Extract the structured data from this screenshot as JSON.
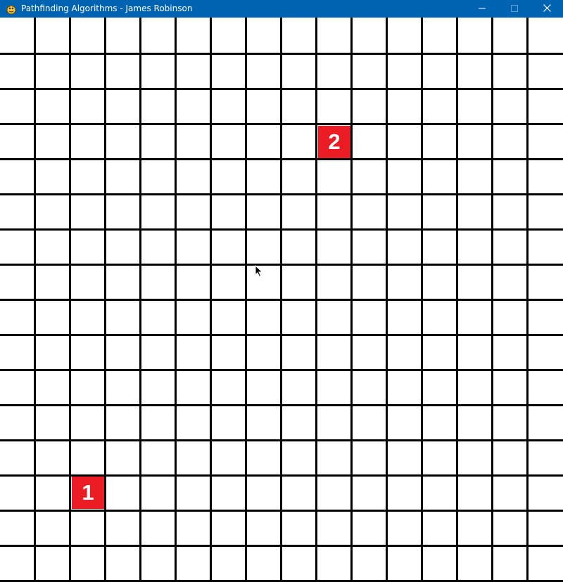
{
  "window": {
    "title": "Pathfinding Algorithms - James Robinson",
    "titlebar_color": "#0063b1",
    "icon": "pygame-snake-icon",
    "controls": [
      "minimize-icon",
      "maximize-icon",
      "close-icon"
    ]
  },
  "grid": {
    "columns": 16,
    "rows": 16,
    "cell_color": "#ffffff",
    "line_color": "#000000"
  },
  "nodes": [
    {
      "label": "1",
      "column": 2,
      "row": 13,
      "color": "#ec1c24"
    },
    {
      "label": "2",
      "column": 9,
      "row": 3,
      "color": "#ec1c24"
    }
  ],
  "cursor": "mouse-pointer-icon"
}
